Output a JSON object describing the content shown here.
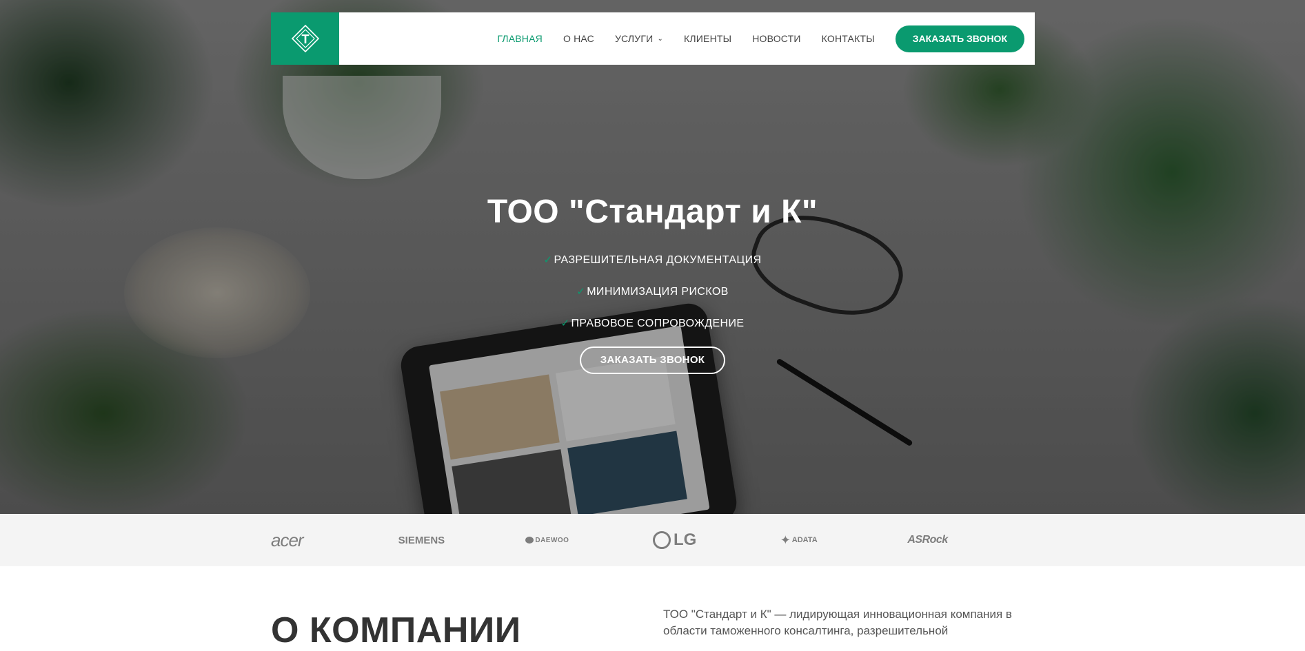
{
  "nav": {
    "logo_letter": "Т",
    "items": [
      {
        "label": "ГЛАВНАЯ",
        "active": true
      },
      {
        "label": "О НАС",
        "active": false
      },
      {
        "label": "УСЛУГИ",
        "active": false,
        "has_dropdown": true
      },
      {
        "label": "КЛИЕНТЫ",
        "active": false
      },
      {
        "label": "НОВОСТИ",
        "active": false
      },
      {
        "label": "КОНТАКТЫ",
        "active": false
      }
    ],
    "cta_label": "ЗАКАЗАТЬ ЗВОНОК"
  },
  "hero": {
    "title": "ТОО \"Стандарт и К\"",
    "bullets": [
      "РАЗРЕШИТЕЛЬНАЯ ДОКУМЕНТАЦИЯ",
      "МИНИМИЗАЦИЯ РИСКОВ",
      "ПРАВОВОЕ СОПРОВОЖДЕНИЕ"
    ],
    "check_glyph": "✓",
    "cta_label": "ЗАКАЗАТЬ ЗВОНОК"
  },
  "clients": {
    "logos": [
      "acer",
      "SIEMENS",
      "DAEWOO",
      "LG",
      "ADATA",
      "ASRock"
    ]
  },
  "about": {
    "heading": "О КОМПАНИИ",
    "text": "ТОО \"Стандарт и К\" — лидирующая инновационная компания в области таможенного консалтинга, разрешительной"
  },
  "colors": {
    "accent": "#0a9a6f",
    "nav_text": "#444444",
    "client_logo": "#7d7d7d"
  }
}
